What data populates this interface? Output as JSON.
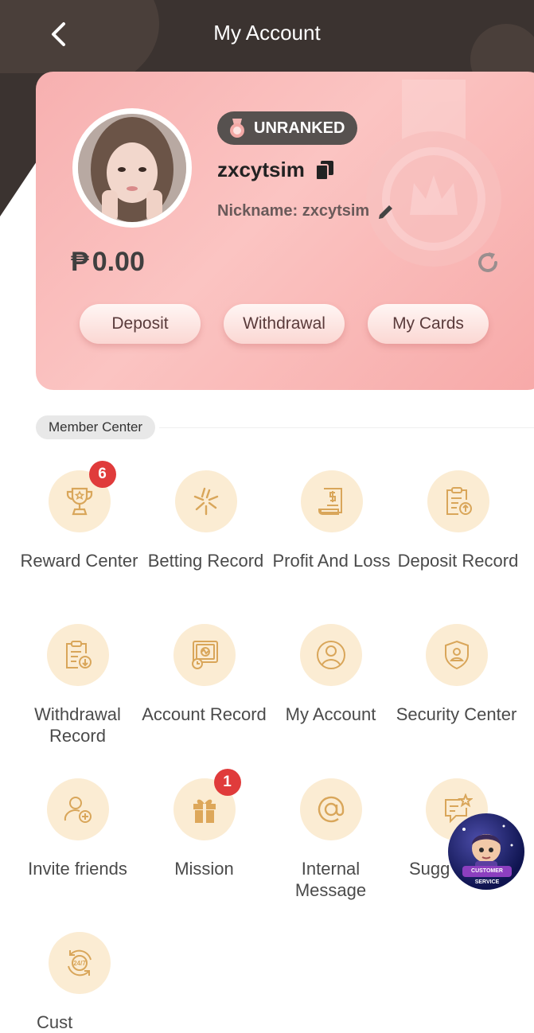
{
  "header": {
    "title": "My Account"
  },
  "profile": {
    "rank": "UNRANKED",
    "username": "zxcytsim",
    "nickname": "Nickname: zxcytsim",
    "currency": "₱",
    "balance": "0.00"
  },
  "actions": {
    "deposit": "Deposit",
    "withdrawal": "Withdrawal",
    "cards": "My Cards"
  },
  "section": {
    "title": "Member Center"
  },
  "menu": [
    {
      "label": "Reward Center",
      "icon": "trophy-icon",
      "badge": "6"
    },
    {
      "label": "Betting Record",
      "icon": "betting-icon"
    },
    {
      "label": "Profit And Loss",
      "icon": "receipt-dollar-icon"
    },
    {
      "label": "Deposit Record",
      "icon": "clipboard-upload-icon"
    },
    {
      "label": "Withdrawal Record",
      "icon": "clipboard-download-icon"
    },
    {
      "label": "Account Record",
      "icon": "account-record-icon"
    },
    {
      "label": "My Account",
      "icon": "user-circle-icon"
    },
    {
      "label": "Security Center",
      "icon": "shield-user-icon"
    },
    {
      "label": "Invite friends",
      "icon": "user-add-icon"
    },
    {
      "label": "Mission",
      "icon": "gift-icon",
      "badge": "1"
    },
    {
      "label": "Internal Message",
      "icon": "at-icon"
    },
    {
      "label": "Sugg",
      "icon": "chat-star-icon"
    },
    {
      "label": "Cust",
      "icon": "support-24-7-icon"
    }
  ],
  "customer_service": {
    "label": "CUSTOMER SERVICE"
  },
  "colors": {
    "header_bg": "#3b3330",
    "card_pink": "#f7b0b0",
    "icon_gold": "#d9a65a",
    "icon_bg": "#fbecd3",
    "badge_red": "#e03b3b"
  }
}
